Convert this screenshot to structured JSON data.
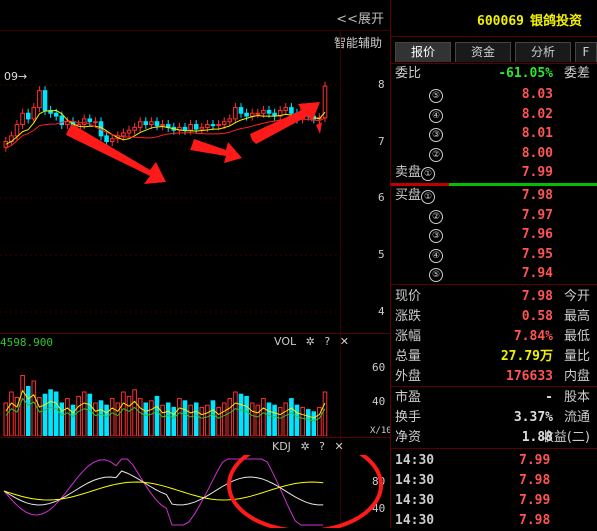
{
  "chart": {
    "expand_label": "<<展开",
    "smart_assist": "智能辅助",
    "marker_label": "09→",
    "price_ticks": [
      "8",
      "7",
      "6",
      "5",
      "4"
    ],
    "vol_value": "4598.900",
    "vol_title": "VOL",
    "vol_ticks": [
      "60",
      "40",
      "X/10"
    ],
    "kdj_title": "KDJ",
    "kdj_ticks": [
      "80",
      "40"
    ],
    "help": "?",
    "close": "✕",
    "gear": "✲",
    "colors": {
      "up": "#ff3030",
      "down": "#00e5ff",
      "arrow": "#ff1a1a",
      "ma1": "#f0f000",
      "ma2": "#ff2020",
      "ma3": "#2ec52e",
      "k": "#e8e8e8",
      "d": "#ffff00",
      "j": "#d030d0",
      "annotation": "#ff1a1a"
    }
  },
  "quote": {
    "code": "600069",
    "name": "银鸽投资",
    "tabs": [
      "报价",
      "资金",
      "分析",
      "F"
    ],
    "weibi_label": "委比",
    "weibi_value": "-61.05%",
    "weicha_label": "委差",
    "sells": [
      {
        "label": "⑤",
        "price": "8.03"
      },
      {
        "label": "④",
        "price": "8.02"
      },
      {
        "label": "③",
        "price": "8.01"
      },
      {
        "label": "②",
        "price": "8.00"
      },
      {
        "label": "卖盘①",
        "price": "7.99"
      }
    ],
    "buys": [
      {
        "label": "买盘①",
        "price": "7.98"
      },
      {
        "label": "②",
        "price": "7.97"
      },
      {
        "label": "③",
        "price": "7.96"
      },
      {
        "label": "④",
        "price": "7.95"
      },
      {
        "label": "⑤",
        "price": "7.94"
      }
    ],
    "stats": [
      {
        "l": "现价",
        "v": "7.98",
        "r": "今开"
      },
      {
        "l": "涨跌",
        "v": "0.58",
        "r": "最高"
      },
      {
        "l": "涨幅",
        "v": "7.84%",
        "r": "最低"
      },
      {
        "l": "总量",
        "v": "27.79万",
        "r": "量比"
      },
      {
        "l": "外盘",
        "v": "176633",
        "r": "内盘"
      }
    ],
    "stats2": [
      {
        "l": "市盈",
        "v": "-",
        "r": "股本"
      },
      {
        "l": "换手",
        "v": "3.37%",
        "r": "流通"
      },
      {
        "l": "净资",
        "v": "1.88",
        "r": "收益(二)"
      }
    ],
    "ticks": [
      {
        "t": "14:30",
        "p": "7.99"
      },
      {
        "t": "14:30",
        "p": "7.98"
      },
      {
        "t": "14:30",
        "p": "7.99"
      },
      {
        "t": "14:30",
        "p": "7.98"
      }
    ]
  }
}
